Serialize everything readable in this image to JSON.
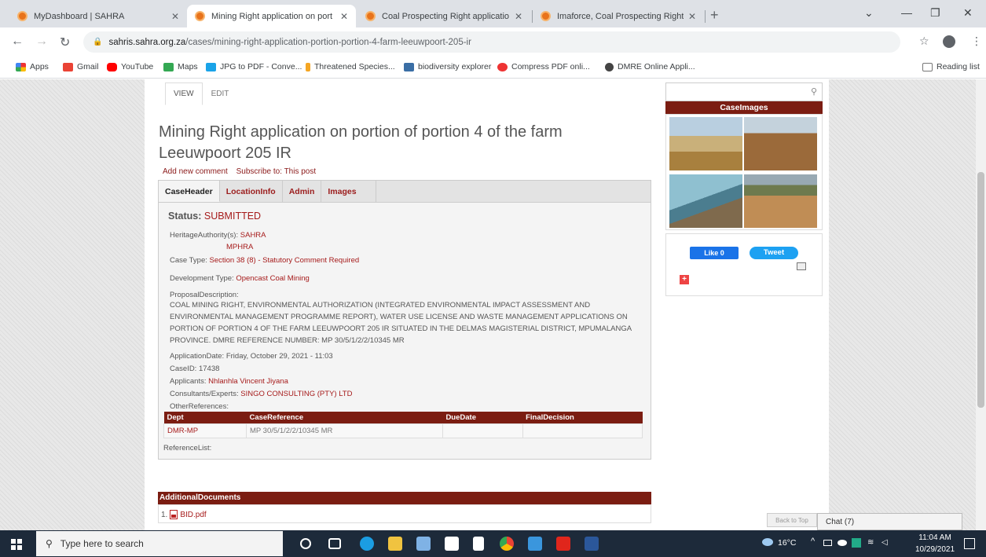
{
  "browser": {
    "tabs": [
      {
        "title": "MyDashboard | SAHRA",
        "active": false
      },
      {
        "title": "Mining Right application on port",
        "active": true
      },
      {
        "title": "Coal Prospecting Right applicatio",
        "active": false
      },
      {
        "title": "Imaforce, Coal Prospecting Right",
        "active": false
      }
    ],
    "new_tab": "+",
    "url_host": "sahris.sahra.org.za",
    "url_path": "/cases/mining-right-application-portion-portion-4-farm-leeuwpoort-205-ir",
    "bookmarks": [
      "Apps",
      "Gmail",
      "YouTube",
      "Maps",
      "JPG to PDF - Conve...",
      "Threatened Species...",
      "biodiversity explorer",
      "Compress PDF onli...",
      "DMRE Online Appli..."
    ],
    "reading_list": "Reading list"
  },
  "page": {
    "view_tab": "VIEW",
    "edit_tab": "EDIT",
    "title": "Mining Right application on portion of portion 4 of the farm Leeuwpoort 205 IR",
    "add_comment": "Add new comment",
    "subscribe": "Subscribe to: This post",
    "case_tabs": [
      "CaseHeader",
      "LocationInfo",
      "Admin",
      "Images"
    ],
    "status_label": "Status:",
    "status_value": "SUBMITTED",
    "heritage_label": "HeritageAuthority(s):",
    "heritage_values": [
      "SAHRA",
      "MPHRA"
    ],
    "case_type_label": "Case Type:",
    "case_type_value": "Section 38 (8) - Statutory Comment Required",
    "dev_type_label": "Development Type:",
    "dev_type_value": "Opencast Coal Mining",
    "proposal_label": "ProposalDescription:",
    "proposal_text": "COAL MINING RIGHT, ENVIRONMENTAL AUTHORIZATION (INTEGRATED ENVIRONMENTAL IMPACT ASSESSMENT AND ENVIRONMENTAL MANAGEMENT PROGRAMME REPORT), WATER USE LICENSE AND WASTE MANAGEMENT APPLICATIONS ON PORTION OF PORTION 4 OF THE FARM LEEUWPOORT 205 IR SITUATED IN THE DELMAS MAGISTERIAL DISTRICT, MPUMALANGA PROVINCE. DMRE REFERENCE NUMBER: MP 30/5/1/2/2/10345 MR",
    "appdate_label": "ApplicationDate:",
    "appdate_value": "Friday, October 29, 2021 - 11:03",
    "caseid_label": "CaseID:",
    "caseid_value": "17438",
    "applicants_label": "Applicants:",
    "applicants_value": "Nhlanhla Vincent Jiyana",
    "consultants_label": "Consultants/Experts:",
    "consultants_value": "SINGO CONSULTING (PTY) LTD",
    "otherrefs_label": "OtherReferences:",
    "ref_headers": [
      "Dept",
      "CaseReference",
      "DueDate",
      "FinalDecision"
    ],
    "ref_rows": [
      [
        "DMR-MP",
        "MP 30/5/1/2/2/10345 MR",
        "",
        ""
      ]
    ],
    "reflist_label": "ReferenceList:",
    "additional_docs": "AdditionalDocuments",
    "doc_number": "1.",
    "doc_name": "BID.pdf"
  },
  "sidebar": {
    "caseimages": "CaseImages",
    "fb_like": "Like 0",
    "tweet": "Tweet",
    "back_to_top": "Back to Top",
    "chat": "Chat (7)"
  },
  "taskbar": {
    "search_placeholder": "Type here to search",
    "weather": "16°C",
    "time": "11:04 AM",
    "date": "10/29/2021"
  }
}
